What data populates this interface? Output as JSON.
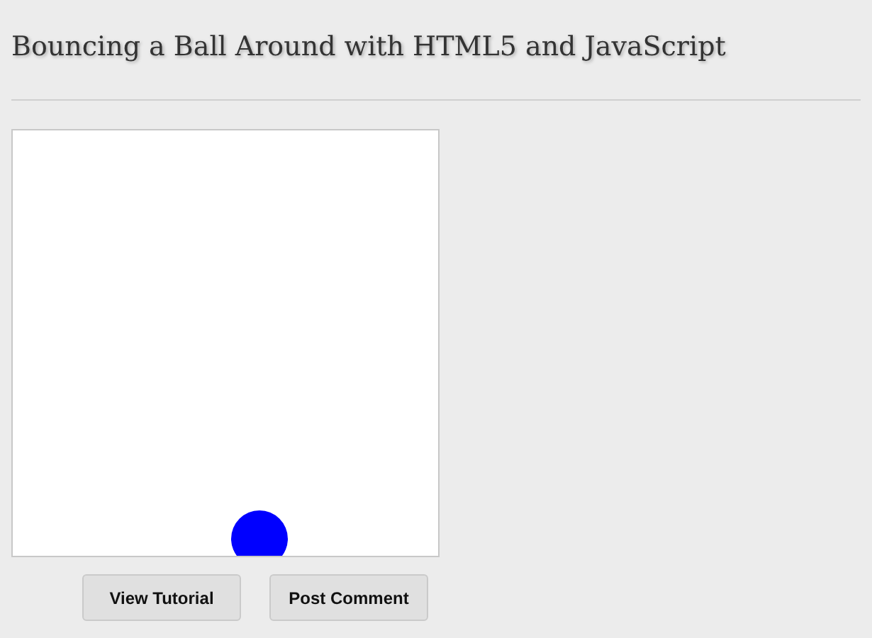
{
  "title": "Bouncing a Ball Around with HTML5 and JavaScript",
  "buttons": [
    {
      "label": "View Tutorial"
    },
    {
      "label": "Post Comment"
    }
  ]
}
